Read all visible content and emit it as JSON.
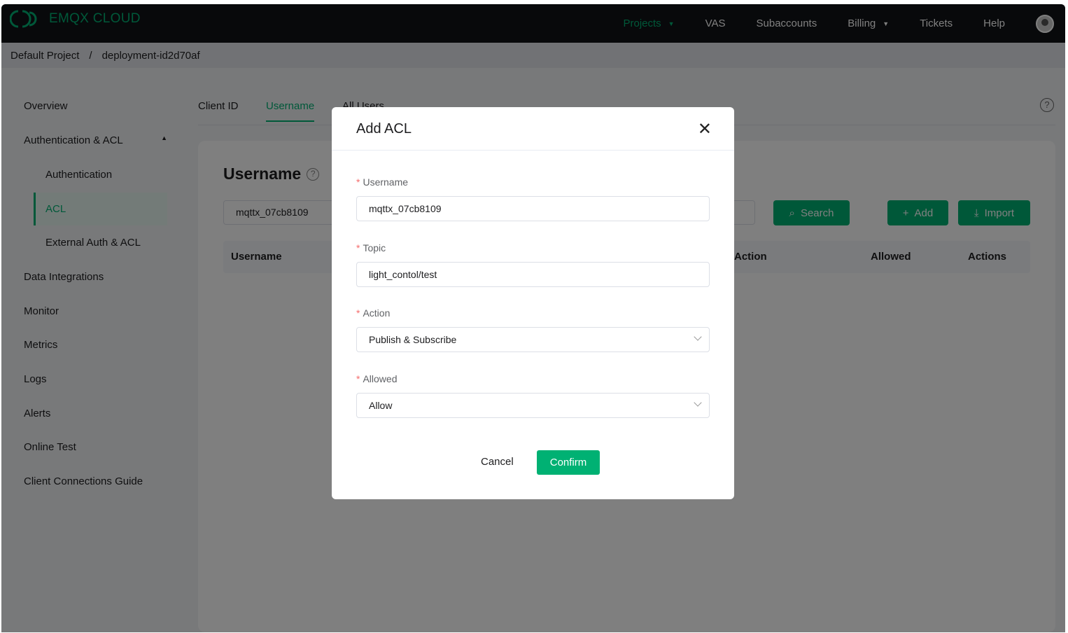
{
  "brand": {
    "name": "EMQX CLOUD"
  },
  "nav": [
    "Projects",
    "VAS",
    "Subaccounts",
    "Billing",
    "Tickets",
    "Help"
  ],
  "breadcrumb": {
    "project": "Default Project",
    "sep": "/",
    "deployment": "deployment-id2d70af"
  },
  "sidebar": [
    "Overview",
    "Authentication & ACL",
    "Authentication",
    "ACL",
    "External Auth & ACL",
    "Data Integrations",
    "Monitor",
    "Metrics",
    "Logs",
    "Alerts",
    "Online Test",
    "Client Connections Guide"
  ],
  "tabs": [
    "Client ID",
    "Username",
    "All Users"
  ],
  "content": {
    "title": "Username",
    "search_value": "mqttx_07cb8109",
    "search": "Search",
    "add": "Add",
    "import": "Import",
    "columns": [
      "Username",
      "Action",
      "Allowed",
      "Actions"
    ]
  },
  "modal": {
    "title": "Add ACL",
    "username_label": "Username",
    "username_value": "mqttx_07cb8109",
    "topic_label": "Topic",
    "topic_value": "light_contol/test",
    "action_label": "Action",
    "action_value": "Publish & Subscribe",
    "allowed_label": "Allowed",
    "allowed_value": "Allow",
    "cancel": "Cancel",
    "confirm": "Confirm"
  },
  "colors": {
    "accent": "#00b173",
    "header": "#111216"
  }
}
